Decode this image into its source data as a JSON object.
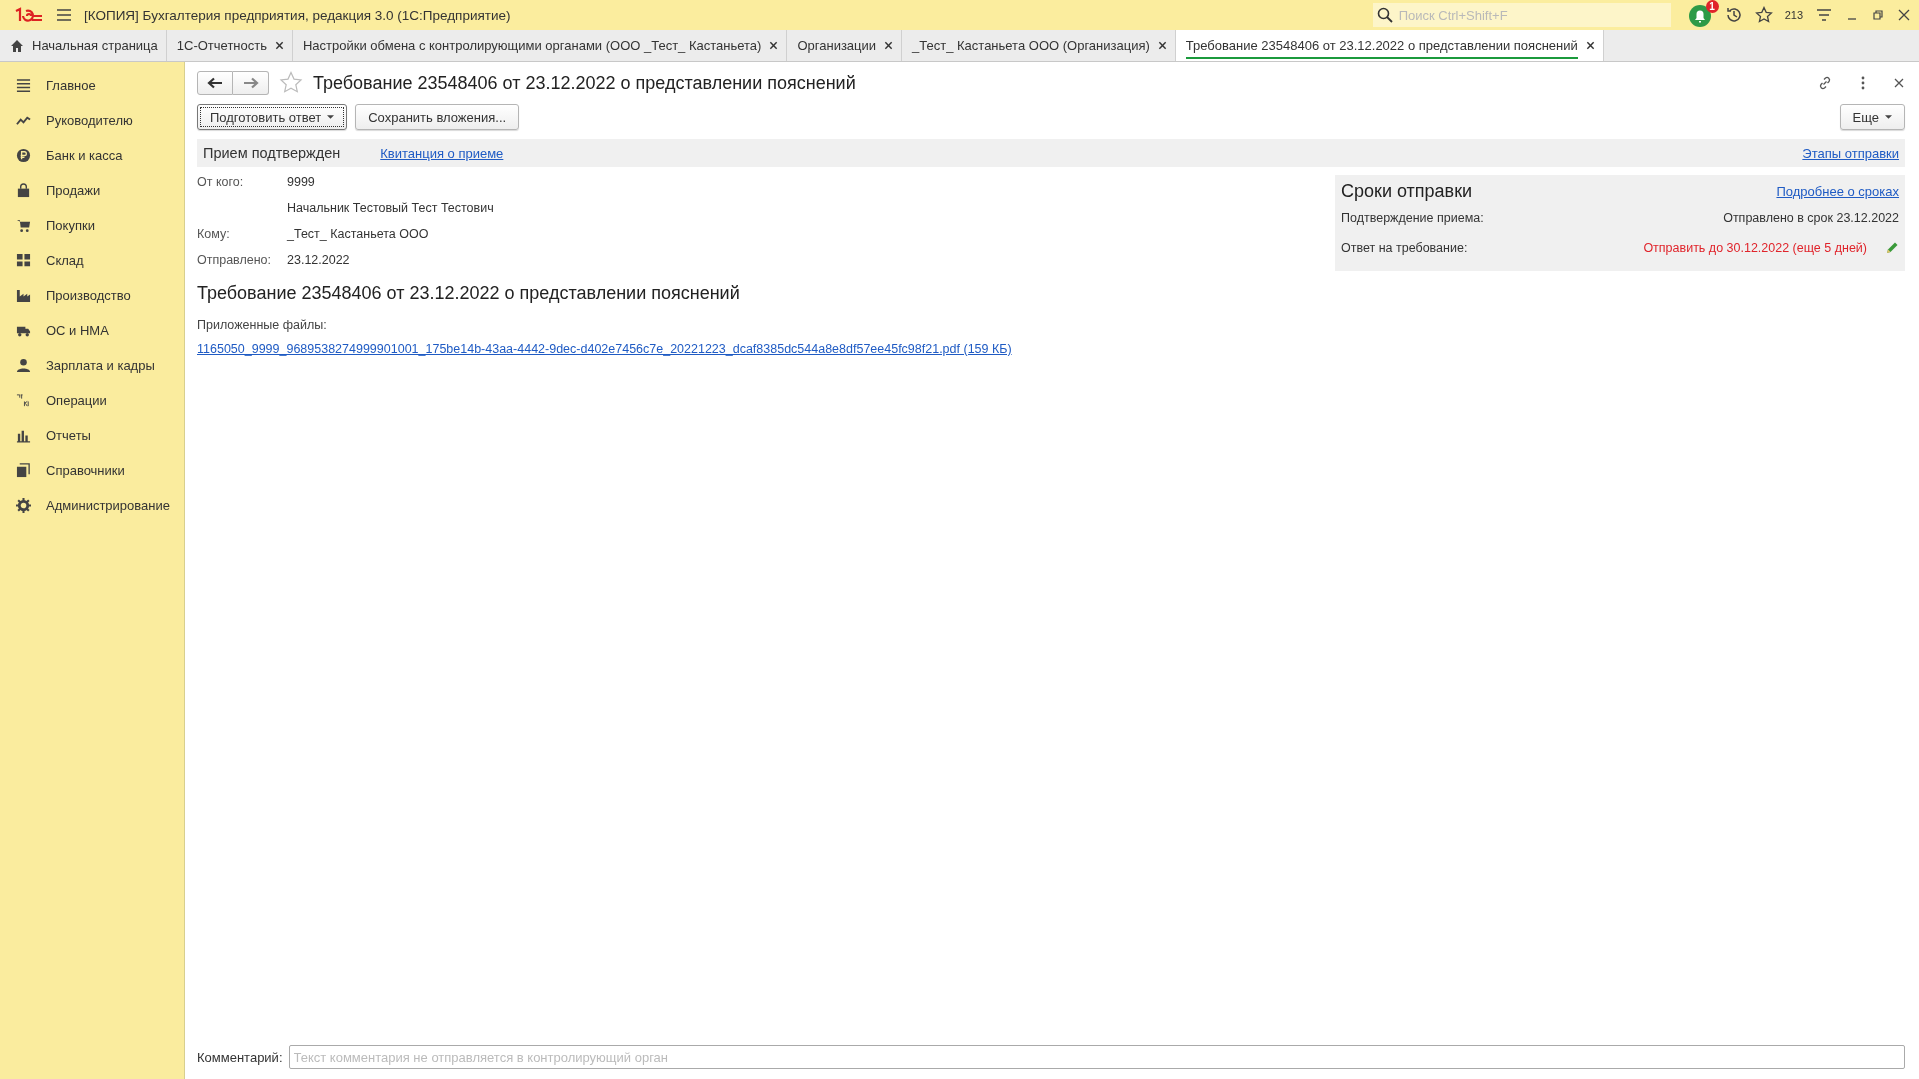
{
  "window": {
    "title": "[КОПИЯ] Бухгалтерия предприятия, редакция 3.0  (1С:Предприятие)",
    "search_placeholder": "Поиск Ctrl+Shift+F",
    "notification_badge": "1",
    "favorites_count": "213"
  },
  "tabs": [
    {
      "label": "Начальная страница",
      "kind": "home",
      "selected": false
    },
    {
      "label": "1С-Отчетность",
      "kind": "closable",
      "selected": false
    },
    {
      "label": "Настройки обмена с контролирующими органами (ООО _Тест_ Кастаньета)",
      "kind": "closable",
      "selected": false
    },
    {
      "label": "Организации",
      "kind": "closable",
      "selected": false
    },
    {
      "label": "_Тест_ Кастаньета ООО (Организация)",
      "kind": "closable",
      "selected": false
    },
    {
      "label": "Требование 23548406 от 23.12.2022 о представлении пояснений",
      "kind": "closable",
      "selected": true
    }
  ],
  "sidebar": {
    "items": [
      {
        "label": "Главное",
        "kind": "menu"
      },
      {
        "label": "Руководителю",
        "kind": "trend"
      },
      {
        "label": "Банк и касса",
        "kind": "coin"
      },
      {
        "label": "Продажи",
        "kind": "bag"
      },
      {
        "label": "Покупки",
        "kind": "cart"
      },
      {
        "label": "Склад",
        "kind": "grid"
      },
      {
        "label": "Производство",
        "kind": "factory"
      },
      {
        "label": "ОС и НМА",
        "kind": "truck"
      },
      {
        "label": "Зарплата и кадры",
        "kind": "person"
      },
      {
        "label": "Операции",
        "kind": "dtkt"
      },
      {
        "label": "Отчеты",
        "kind": "bars"
      },
      {
        "label": "Справочники",
        "kind": "books"
      },
      {
        "label": "Администрирование",
        "kind": "gear"
      }
    ]
  },
  "form": {
    "title": "Требование 23548406 от 23.12.2022 о представлении пояснений",
    "buttons": [
      {
        "label": "Подготовить ответ",
        "dropdown": true,
        "focused": true
      },
      {
        "label": "Сохранить вложения...",
        "dropdown": false,
        "focused": false
      }
    ],
    "more_button": "Еще",
    "status": {
      "text": "Прием подтвержден",
      "link": "Квитанция о приеме",
      "right_link": "Этапы отправки"
    },
    "fields": [
      {
        "label": "От кого:",
        "values": [
          "9999",
          "Начальник Тестовый Тест Тестович"
        ]
      },
      {
        "label": "Кому:",
        "values": [
          "_Тест_ Кастаньета ООО"
        ]
      },
      {
        "label": "Отправлено:",
        "values": [
          "23.12.2022"
        ]
      }
    ],
    "heading": "Требование 23548406 от 23.12.2022 о представлении пояснений",
    "attachments_label": "Приложенные файлы:",
    "attachments": [
      "1165050_9999_9689538274999901001_175be14b-43aa-4442-9dec-d402e7456c7e_20221223_dcaf8385dc544a8e8df57ee45fc98f21.pdf (159 КБ)"
    ],
    "deadlines": {
      "title": "Сроки отправки",
      "link": "Подробнее о сроках",
      "rows": [
        {
          "label": "Подтверждение приема:",
          "value": "Отправлено в срок 23.12.2022",
          "overdue_warning": false,
          "editable": false
        },
        {
          "label": "Ответ на требование:",
          "value": "Отправить до 30.12.2022 (еще 5 дней)",
          "overdue_warning": true,
          "editable": true
        }
      ]
    },
    "comment": {
      "label": "Комментарий:",
      "placeholder": "Текст комментария не отправляется в контролирующий орган"
    }
  }
}
